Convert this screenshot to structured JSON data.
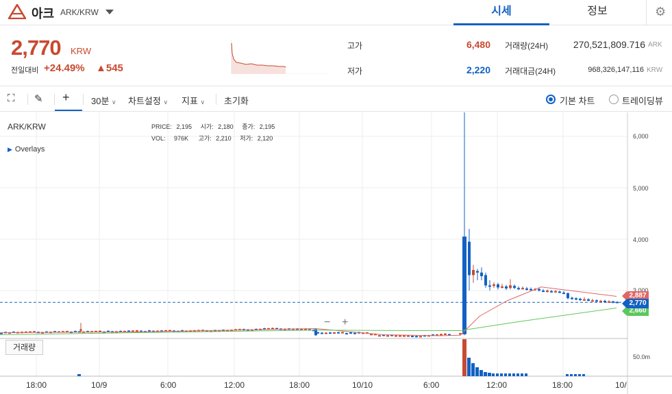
{
  "header": {
    "coin_name": "아크",
    "pair": "ARK/KRW",
    "tabs": [
      {
        "label": "시세",
        "active": true
      },
      {
        "label": "정보",
        "active": false
      }
    ],
    "logo_color": "#c84a31"
  },
  "summary": {
    "price": "2,770",
    "unit": "KRW",
    "change_label": "전일대비",
    "change_pct": "+24.49%",
    "change_abs": "▲545",
    "high_label": "고가",
    "high_value": "6,480",
    "low_label": "저가",
    "low_value": "2,220",
    "volume_label": "거래량(24H)",
    "volume_value": "270,521,809.716",
    "volume_unit": "ARK",
    "amount_label": "거래대금(24H)",
    "amount_value": "968,326,147,116",
    "amount_unit": "KRW"
  },
  "toolbar": {
    "interval": "30분",
    "chart_settings": "차트설정",
    "indicators": "지표",
    "reset": "초기화",
    "basic_chart": "기본 차트",
    "tradingview": "트레이딩뷰",
    "basic_selected": true
  },
  "chart": {
    "pair_label": "ARK/KRW",
    "overlays": "Overlays",
    "legend_row1": [
      "PRICE:",
      "2,195",
      "시가:",
      "2,180",
      "종가:",
      "2,195"
    ],
    "legend_row2": [
      "VOL:",
      "976K",
      "고가:",
      "2,210",
      "저가:",
      "2,120"
    ],
    "volume_button": "거래량",
    "price_tag_current": "2,770",
    "price_tag_ma_red": "2,887",
    "price_tag_ma_green": "2,660",
    "volume_tick": "50.0m",
    "colors": {
      "up": "#c84a31",
      "down": "#1261c4",
      "ma_short": "#e06666",
      "ma_long": "#5cc75c"
    }
  },
  "chart_data": {
    "type": "candlestick",
    "y_ticks": [
      "6,000",
      "5,000",
      "4,000",
      "3,000"
    ],
    "x_ticks": [
      "18:00",
      "10/9",
      "6:00",
      "12:00",
      "18:00",
      "10/10",
      "6:00",
      "12:00",
      "18:00",
      "10/"
    ],
    "current_price": 2770,
    "spike_high": 6480,
    "spike_open": 4050,
    "spike_close": 2150
  }
}
